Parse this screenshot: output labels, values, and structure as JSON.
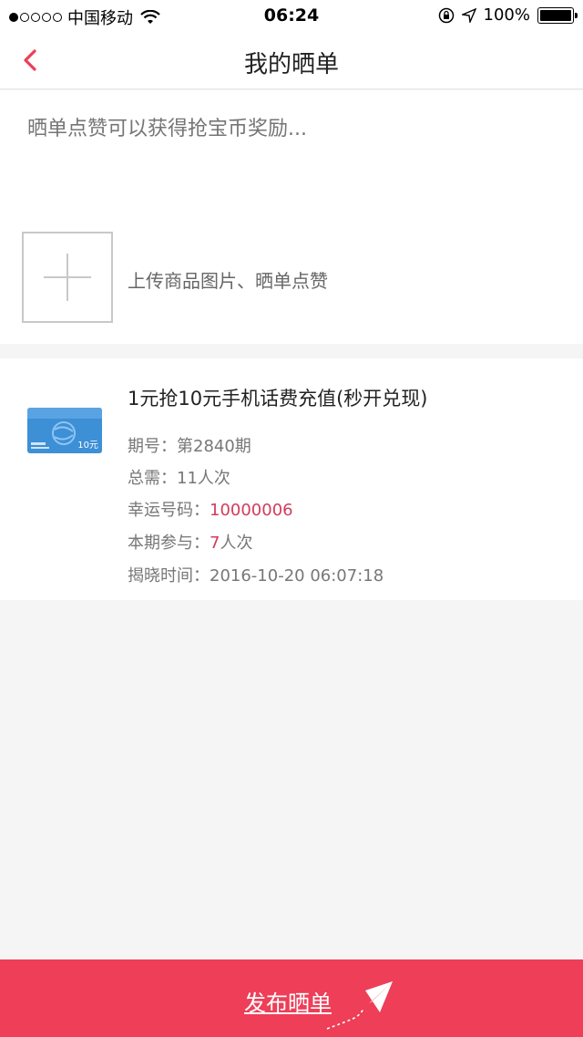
{
  "status_bar": {
    "carrier": "中国移动",
    "time": "06:24",
    "battery": "100%",
    "signal_dots_filled": 1,
    "signal_dots_total": 5
  },
  "nav": {
    "title": "我的晒单",
    "back_icon": "chevron-left-icon"
  },
  "compose": {
    "placeholder": "晒单点赞可以获得抢宝币奖励...",
    "upload_label": "上传商品图片、晒单点赞"
  },
  "product": {
    "title": "1元抢10元手机话费充值(秒开兑现)",
    "card_price": "10元",
    "rows": [
      {
        "label": "期号：",
        "value": "第2840期",
        "highlight": false
      },
      {
        "label": "总需：",
        "value": "11人次",
        "highlight": false
      },
      {
        "label": "幸运号码：",
        "value": "10000006",
        "highlight": true
      },
      {
        "label": "本期参与：",
        "value": "7",
        "suffix": "人次",
        "highlight": true
      },
      {
        "label": "揭晓时间：",
        "value": "2016-10-20 06:07:18",
        "highlight": false
      }
    ]
  },
  "bottom": {
    "publish_label": "发布晒单"
  },
  "colors": {
    "accent": "#ee3e58",
    "highlight_text": "#d23c5a",
    "background": "#f5f5f5"
  }
}
